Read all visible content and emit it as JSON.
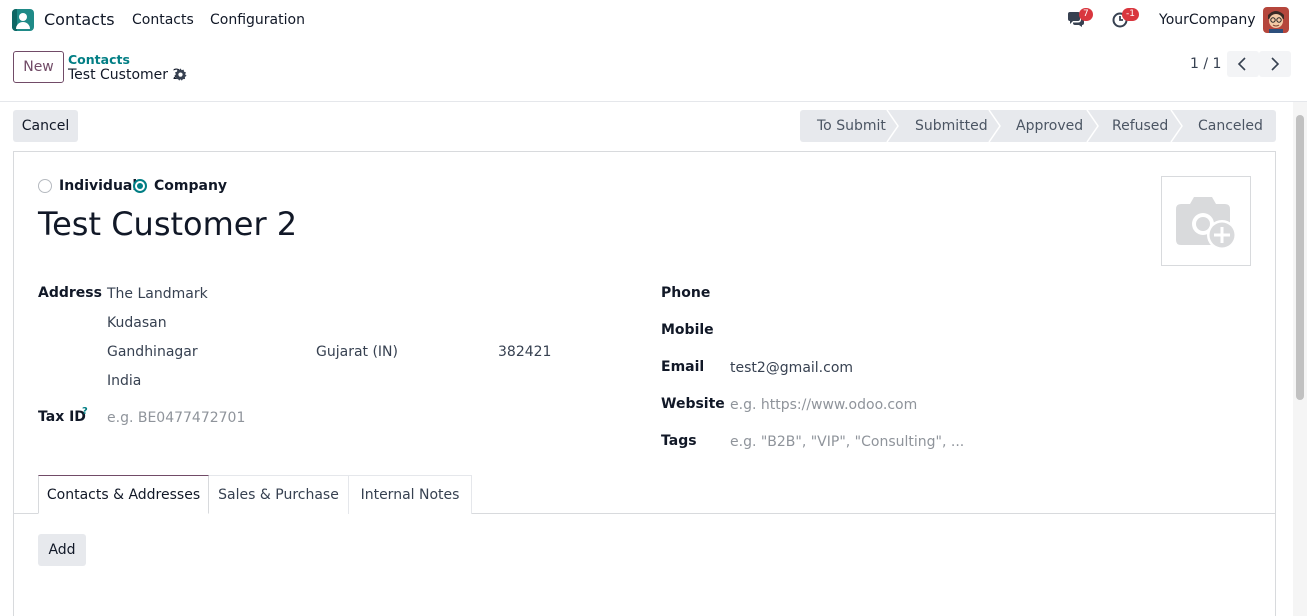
{
  "navbar": {
    "app_name": "Contacts",
    "menu": [
      "Contacts",
      "Configuration"
    ],
    "messages_badge": "7",
    "activities_badge": "-1",
    "company": "YourCompany"
  },
  "control_panel": {
    "new_label": "New",
    "breadcrumb_parent": "Contacts",
    "record_title": "Test Customer 2",
    "pager": "1 / 1"
  },
  "actions": {
    "cancel_label": "Cancel"
  },
  "statusbar": {
    "stages": [
      "To Submit",
      "Submitted",
      "Approved",
      "Refused",
      "Canceled"
    ]
  },
  "form": {
    "company_type": {
      "options": [
        "Individual",
        "Company"
      ],
      "selected": "Company"
    },
    "name": "Test Customer 2",
    "address": {
      "label": "Address",
      "street": "The Landmark",
      "street2": "Kudasan",
      "city": "Gandhinagar",
      "state": "Gujarat (IN)",
      "zip": "382421",
      "country": "India"
    },
    "tax_id": {
      "label": "Tax ID",
      "help_mark": "?",
      "placeholder": "e.g. BE0477472701"
    },
    "phone": {
      "label": "Phone",
      "value": ""
    },
    "mobile": {
      "label": "Mobile",
      "value": ""
    },
    "email": {
      "label": "Email",
      "value": "test2@gmail.com"
    },
    "website": {
      "label": "Website",
      "placeholder": "e.g. https://www.odoo.com"
    },
    "tags": {
      "label": "Tags",
      "placeholder": "e.g. \"B2B\", \"VIP\", \"Consulting\", ..."
    }
  },
  "notebook": {
    "tabs": [
      "Contacts & Addresses",
      "Sales & Purchase",
      "Internal Notes"
    ],
    "active_tab": "Contacts & Addresses",
    "add_label": "Add"
  },
  "colors": {
    "brand": "#714b67",
    "accent": "#017e84",
    "badge": "#d9363e"
  }
}
